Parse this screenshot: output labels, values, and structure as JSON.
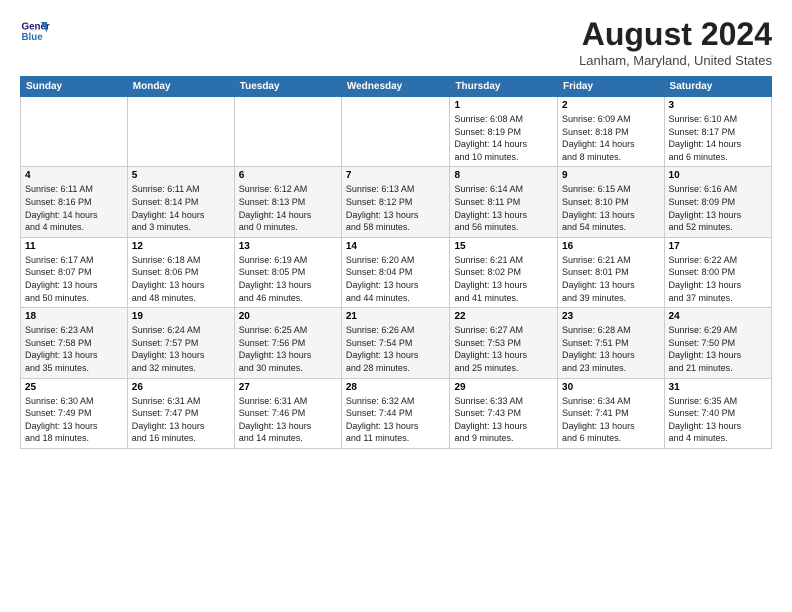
{
  "header": {
    "logo_line1": "General",
    "logo_line2": "Blue",
    "title": "August 2024",
    "location": "Lanham, Maryland, United States"
  },
  "weekdays": [
    "Sunday",
    "Monday",
    "Tuesday",
    "Wednesday",
    "Thursday",
    "Friday",
    "Saturday"
  ],
  "weeks": [
    [
      {
        "day": "",
        "info": ""
      },
      {
        "day": "",
        "info": ""
      },
      {
        "day": "",
        "info": ""
      },
      {
        "day": "",
        "info": ""
      },
      {
        "day": "1",
        "info": "Sunrise: 6:08 AM\nSunset: 8:19 PM\nDaylight: 14 hours\nand 10 minutes."
      },
      {
        "day": "2",
        "info": "Sunrise: 6:09 AM\nSunset: 8:18 PM\nDaylight: 14 hours\nand 8 minutes."
      },
      {
        "day": "3",
        "info": "Sunrise: 6:10 AM\nSunset: 8:17 PM\nDaylight: 14 hours\nand 6 minutes."
      }
    ],
    [
      {
        "day": "4",
        "info": "Sunrise: 6:11 AM\nSunset: 8:16 PM\nDaylight: 14 hours\nand 4 minutes."
      },
      {
        "day": "5",
        "info": "Sunrise: 6:11 AM\nSunset: 8:14 PM\nDaylight: 14 hours\nand 3 minutes."
      },
      {
        "day": "6",
        "info": "Sunrise: 6:12 AM\nSunset: 8:13 PM\nDaylight: 14 hours\nand 0 minutes."
      },
      {
        "day": "7",
        "info": "Sunrise: 6:13 AM\nSunset: 8:12 PM\nDaylight: 13 hours\nand 58 minutes."
      },
      {
        "day": "8",
        "info": "Sunrise: 6:14 AM\nSunset: 8:11 PM\nDaylight: 13 hours\nand 56 minutes."
      },
      {
        "day": "9",
        "info": "Sunrise: 6:15 AM\nSunset: 8:10 PM\nDaylight: 13 hours\nand 54 minutes."
      },
      {
        "day": "10",
        "info": "Sunrise: 6:16 AM\nSunset: 8:09 PM\nDaylight: 13 hours\nand 52 minutes."
      }
    ],
    [
      {
        "day": "11",
        "info": "Sunrise: 6:17 AM\nSunset: 8:07 PM\nDaylight: 13 hours\nand 50 minutes."
      },
      {
        "day": "12",
        "info": "Sunrise: 6:18 AM\nSunset: 8:06 PM\nDaylight: 13 hours\nand 48 minutes."
      },
      {
        "day": "13",
        "info": "Sunrise: 6:19 AM\nSunset: 8:05 PM\nDaylight: 13 hours\nand 46 minutes."
      },
      {
        "day": "14",
        "info": "Sunrise: 6:20 AM\nSunset: 8:04 PM\nDaylight: 13 hours\nand 44 minutes."
      },
      {
        "day": "15",
        "info": "Sunrise: 6:21 AM\nSunset: 8:02 PM\nDaylight: 13 hours\nand 41 minutes."
      },
      {
        "day": "16",
        "info": "Sunrise: 6:21 AM\nSunset: 8:01 PM\nDaylight: 13 hours\nand 39 minutes."
      },
      {
        "day": "17",
        "info": "Sunrise: 6:22 AM\nSunset: 8:00 PM\nDaylight: 13 hours\nand 37 minutes."
      }
    ],
    [
      {
        "day": "18",
        "info": "Sunrise: 6:23 AM\nSunset: 7:58 PM\nDaylight: 13 hours\nand 35 minutes."
      },
      {
        "day": "19",
        "info": "Sunrise: 6:24 AM\nSunset: 7:57 PM\nDaylight: 13 hours\nand 32 minutes."
      },
      {
        "day": "20",
        "info": "Sunrise: 6:25 AM\nSunset: 7:56 PM\nDaylight: 13 hours\nand 30 minutes."
      },
      {
        "day": "21",
        "info": "Sunrise: 6:26 AM\nSunset: 7:54 PM\nDaylight: 13 hours\nand 28 minutes."
      },
      {
        "day": "22",
        "info": "Sunrise: 6:27 AM\nSunset: 7:53 PM\nDaylight: 13 hours\nand 25 minutes."
      },
      {
        "day": "23",
        "info": "Sunrise: 6:28 AM\nSunset: 7:51 PM\nDaylight: 13 hours\nand 23 minutes."
      },
      {
        "day": "24",
        "info": "Sunrise: 6:29 AM\nSunset: 7:50 PM\nDaylight: 13 hours\nand 21 minutes."
      }
    ],
    [
      {
        "day": "25",
        "info": "Sunrise: 6:30 AM\nSunset: 7:49 PM\nDaylight: 13 hours\nand 18 minutes."
      },
      {
        "day": "26",
        "info": "Sunrise: 6:31 AM\nSunset: 7:47 PM\nDaylight: 13 hours\nand 16 minutes."
      },
      {
        "day": "27",
        "info": "Sunrise: 6:31 AM\nSunset: 7:46 PM\nDaylight: 13 hours\nand 14 minutes."
      },
      {
        "day": "28",
        "info": "Sunrise: 6:32 AM\nSunset: 7:44 PM\nDaylight: 13 hours\nand 11 minutes."
      },
      {
        "day": "29",
        "info": "Sunrise: 6:33 AM\nSunset: 7:43 PM\nDaylight: 13 hours\nand 9 minutes."
      },
      {
        "day": "30",
        "info": "Sunrise: 6:34 AM\nSunset: 7:41 PM\nDaylight: 13 hours\nand 6 minutes."
      },
      {
        "day": "31",
        "info": "Sunrise: 6:35 AM\nSunset: 7:40 PM\nDaylight: 13 hours\nand 4 minutes."
      }
    ]
  ]
}
